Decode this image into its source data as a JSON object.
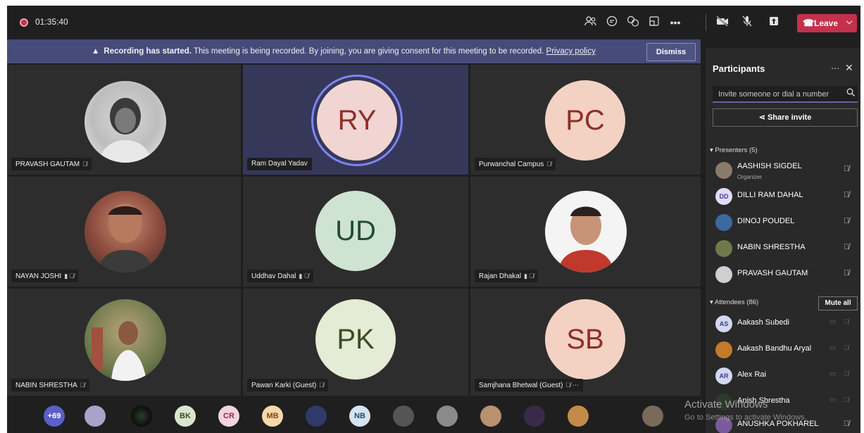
{
  "topbar": {
    "timer": "01:35:40",
    "icons": [
      "people-icon",
      "chat-icon",
      "reactions-icon",
      "rooms-icon",
      "more-icon",
      "camera-off-icon",
      "mic-off-icon",
      "share-icon"
    ],
    "leave_label": "Leave"
  },
  "banner": {
    "bold": "Recording has started.",
    "text": " This meeting is being recorded. By joining, you are giving consent for this meeting to be recorded. ",
    "link": "Privacy policy",
    "dismiss_label": "Dismiss"
  },
  "tiles": [
    {
      "name": "PRAVASH GAUTAM",
      "status": "🎙̸",
      "initials": ""
    },
    {
      "name": "Ram Dayal Yadav",
      "status": "",
      "initials": "RY"
    },
    {
      "name": "Purwanchal Campus",
      "status": "🎙̸",
      "initials": "PC"
    },
    {
      "name": "NAYAN JOSHI",
      "status": "▮ 🎙̸",
      "initials": ""
    },
    {
      "name": "Uddhav Dahal",
      "status": "▮ 🎙̸",
      "initials": "UD"
    },
    {
      "name": "Rajan Dhakal",
      "status": "▮ 🎙̸",
      "initials": ""
    },
    {
      "name": "NABIN SHRESTHA",
      "status": "🎙̸",
      "initials": ""
    },
    {
      "name": "Pawan Karki (Guest)",
      "status": "🎙̸",
      "initials": "PK"
    },
    {
      "name": "Samjhana Bhetwal (Guest)",
      "status": "🎙̸ ⋯",
      "initials": "SB"
    }
  ],
  "strip": {
    "overflow": "+69",
    "avatars": [
      "",
      "",
      "BK",
      "CR",
      "MB",
      "",
      "NB",
      "",
      "",
      "",
      "",
      "",
      ""
    ]
  },
  "panel": {
    "title": "Participants",
    "more": "⋯",
    "close": "✕",
    "invite_placeholder": "Invite someone or dial a number",
    "share_label": "Share invite",
    "presenters_label": "Presenters (5)",
    "attendees_label": "Attendees (86)",
    "mute_all_label": "Mute all",
    "presenters": [
      {
        "name": "AASHISH SIGDEL",
        "sub": "Organizer",
        "initials": ""
      },
      {
        "name": "DILLI RAM DAHAL",
        "sub": "",
        "initials": "DD"
      },
      {
        "name": "DINOJ POUDEL",
        "sub": "",
        "initials": ""
      },
      {
        "name": "NABIN SHRESTHA",
        "sub": "",
        "initials": ""
      },
      {
        "name": "PRAVASH GAUTAM",
        "sub": "",
        "initials": ""
      }
    ],
    "attendees": [
      {
        "name": "Aakash Subedi",
        "initials": "AS"
      },
      {
        "name": "Aakash Bandhu Aryal",
        "initials": ""
      },
      {
        "name": "Alex Rai",
        "initials": "AR"
      },
      {
        "name": "Anish Shrestha",
        "initials": ""
      },
      {
        "name": "ANUSHKA POKHAREL",
        "initials": ""
      }
    ]
  },
  "watermark": {
    "line1": "Activate Windows",
    "line2": "Go to Settings to activate Windows."
  },
  "colors": {
    "accent": "#6264a7",
    "leave": "#c4314b",
    "banner": "#474b7a"
  }
}
